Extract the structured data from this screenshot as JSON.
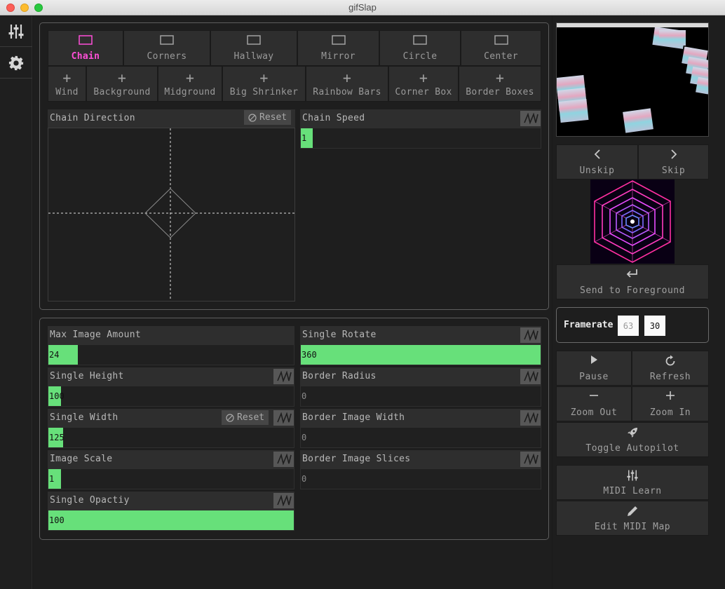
{
  "window": {
    "title": "gifSlap"
  },
  "sidebar": {
    "items": [
      {
        "icon": "sliders-icon"
      },
      {
        "icon": "gear-icon"
      }
    ]
  },
  "modes": {
    "tabs": [
      {
        "label": "Chain",
        "active": true
      },
      {
        "label": "Corners"
      },
      {
        "label": "Hallway"
      },
      {
        "label": "Mirror"
      },
      {
        "label": "Circle"
      },
      {
        "label": "Center"
      }
    ],
    "add_buttons": [
      {
        "label": "Wind"
      },
      {
        "label": "Background"
      },
      {
        "label": "Midground"
      },
      {
        "label": "Big Shrinker"
      },
      {
        "label": "Rainbow Bars"
      },
      {
        "label": "Corner Box"
      },
      {
        "label": "Border Boxes"
      }
    ]
  },
  "chain": {
    "direction_label": "Chain Direction",
    "reset_label": "Reset",
    "speed_label": "Chain Speed",
    "speed_value": "1",
    "speed_fill": 0.05
  },
  "controls": {
    "max_image_amount": {
      "label": "Max Image Amount",
      "value": "24",
      "fill": 0.12
    },
    "single_height": {
      "label": "Single Height",
      "value": "100",
      "fill": 0.05
    },
    "single_width": {
      "label": "Single Width",
      "value": "125",
      "fill": 0.06,
      "reset_label": "Reset"
    },
    "image_scale": {
      "label": "Image Scale",
      "value": "1",
      "fill": 0.05
    },
    "single_opacity": {
      "label": "Single Opactiy",
      "value": "100",
      "fill": 1.0
    },
    "single_rotate": {
      "label": "Single Rotate",
      "value": "360",
      "fill": 1.0
    },
    "border_radius": {
      "label": "Border Radius",
      "value": "0",
      "fill": 0
    },
    "border_image_width": {
      "label": "Border Image Width",
      "value": "0",
      "fill": 0
    },
    "border_image_slices": {
      "label": "Border Image Slices",
      "value": "0",
      "fill": 0
    }
  },
  "right_panel": {
    "unskip_label": "Unskip",
    "skip_label": "Skip",
    "send_to_foreground_label": "Send to Foreground",
    "framerate": {
      "label": "Framerate",
      "current": "63",
      "target": "30"
    },
    "pause_label": "Pause",
    "refresh_label": "Refresh",
    "zoom_out_label": "Zoom Out",
    "zoom_in_label": "Zoom In",
    "toggle_autopilot_label": "Toggle Autopilot",
    "midi_learn_label": "MIDI Learn",
    "edit_midi_map_label": "Edit MIDI Map"
  },
  "colors": {
    "accent_green": "#67e07a",
    "active_tab_pink": "#ff4fd8"
  }
}
